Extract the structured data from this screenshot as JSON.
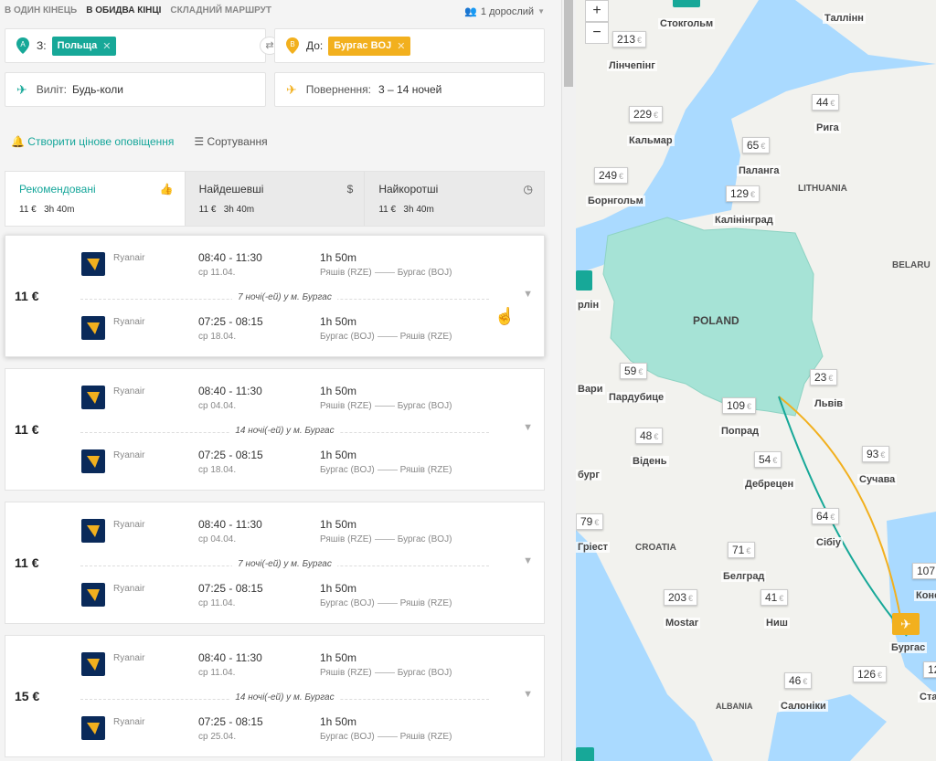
{
  "nav": {
    "one_way": "В ОДИН КІНЕЦЬ",
    "return": "В ОБИДВА КІНЦІ",
    "multi": "СКЛАДНИЙ МАРШРУТ",
    "passengers": "1 дорослий"
  },
  "search": {
    "from_label": "З:",
    "from_chip": "Польща",
    "to_label": "До:",
    "to_chip": "Бургас BOJ",
    "depart_label": "Виліт:",
    "depart_value": "Будь-коли",
    "return_label": "Повернення:",
    "return_value": "3 – 14 ночей"
  },
  "actions": {
    "alert": "Створити цінове оповіщення",
    "sort": "Сортування"
  },
  "tabs": [
    {
      "name": "Рекомендовані",
      "price": "11 €",
      "duration": "3h 40m"
    },
    {
      "name": "Найдешевші",
      "price": "11 €",
      "duration": "3h 40m"
    },
    {
      "name": "Найкоротші",
      "price": "11 €",
      "duration": "3h 40m"
    }
  ],
  "results": [
    {
      "price": "11 €",
      "stay": "7 ночі(-ей) у м. Бургас",
      "out": {
        "airline": "Ryanair",
        "times": "08:40 - 11:30",
        "date": "ср 11.04.",
        "duration": "1h 50m",
        "from": "Ряшів (RZE)",
        "to": "Бургас (BOJ)"
      },
      "back": {
        "airline": "Ryanair",
        "times": "07:25 - 08:15",
        "date": "ср 18.04.",
        "duration": "1h 50m",
        "from": "Бургас (BOJ)",
        "to": "Ряшів (RZE)"
      }
    },
    {
      "price": "11 €",
      "stay": "14 ночі(-ей) у м. Бургас",
      "out": {
        "airline": "Ryanair",
        "times": "08:40 - 11:30",
        "date": "ср 04.04.",
        "duration": "1h 50m",
        "from": "Ряшів (RZE)",
        "to": "Бургас (BOJ)"
      },
      "back": {
        "airline": "Ryanair",
        "times": "07:25 - 08:15",
        "date": "ср 18.04.",
        "duration": "1h 50m",
        "from": "Бургас (BOJ)",
        "to": "Ряшів (RZE)"
      }
    },
    {
      "price": "11 €",
      "stay": "7 ночі(-ей) у м. Бургас",
      "out": {
        "airline": "Ryanair",
        "times": "08:40 - 11:30",
        "date": "ср 04.04.",
        "duration": "1h 50m",
        "from": "Ряшів (RZE)",
        "to": "Бургас (BOJ)"
      },
      "back": {
        "airline": "Ryanair",
        "times": "07:25 - 08:15",
        "date": "ср 11.04.",
        "duration": "1h 50m",
        "from": "Бургас (BOJ)",
        "to": "Ряшів (RZE)"
      }
    },
    {
      "price": "15 €",
      "stay": "14 ночі(-ей) у м. Бургас",
      "out": {
        "airline": "Ryanair",
        "times": "08:40 - 11:30",
        "date": "ср 11.04.",
        "duration": "1h 50m",
        "from": "Ряшів (RZE)",
        "to": "Бургас (BOJ)"
      },
      "back": {
        "airline": "Ryanair",
        "times": "07:25 - 08:15",
        "date": "ср 25.04.",
        "duration": "1h 50m",
        "from": "Бургас (BOJ)",
        "to": "Ряшів (RZE)"
      }
    }
  ],
  "map": {
    "zoom_in": "+",
    "zoom_out": "−",
    "cities": {
      "tallinn": "Таллінн",
      "stockholm": "Стокгольм",
      "linkoping": "Лінчепінг",
      "riga": "Рига",
      "kalmar": "Кальмар",
      "palanga": "Паланга",
      "bornholm": "Борнгольм",
      "kaliningrad": "Калінінград",
      "berlin": "рлін",
      "pardubice": "Пардубице",
      "lviv": "Львів",
      "poprad": "Попрад",
      "vienna": "Відень",
      "debrecen": "Дебрецен",
      "suceava": "Сучава",
      "sibiu": "Сібіу",
      "trieste": "Гріест",
      "belgrade": "Белград",
      "mostar": "Mostar",
      "nis": "Ниш",
      "burgas": "Бургас",
      "thessaloniki": "Салоніки",
      "varna_cut": "Вари",
      "burg_cut": "бург",
      "konst_cut": "Конст",
      "sta_cut": "Ста"
    },
    "countries": {
      "lithuania": "LITHUANIA",
      "poland": "POLAND",
      "belarus": "BELARU",
      "croatia": "CROATIA",
      "albania": "ALBANIA"
    },
    "prices": {
      "p213": "213",
      "p229": "229",
      "p44": "44",
      "p65": "65",
      "p249": "249",
      "p129": "129",
      "p59": "59",
      "p23": "23",
      "p109": "109",
      "p48": "48",
      "p54": "54",
      "p93": "93",
      "p64": "64",
      "p79": "79",
      "p71": "71",
      "p107": "107",
      "p203": "203",
      "p41": "41",
      "p46": "46",
      "p126": "126",
      "p12": "12"
    },
    "currency": "€",
    "colors": {
      "poland_fill": "#a6e3d6",
      "route_green": "#17a898",
      "route_yellow": "#f2b01e"
    }
  }
}
